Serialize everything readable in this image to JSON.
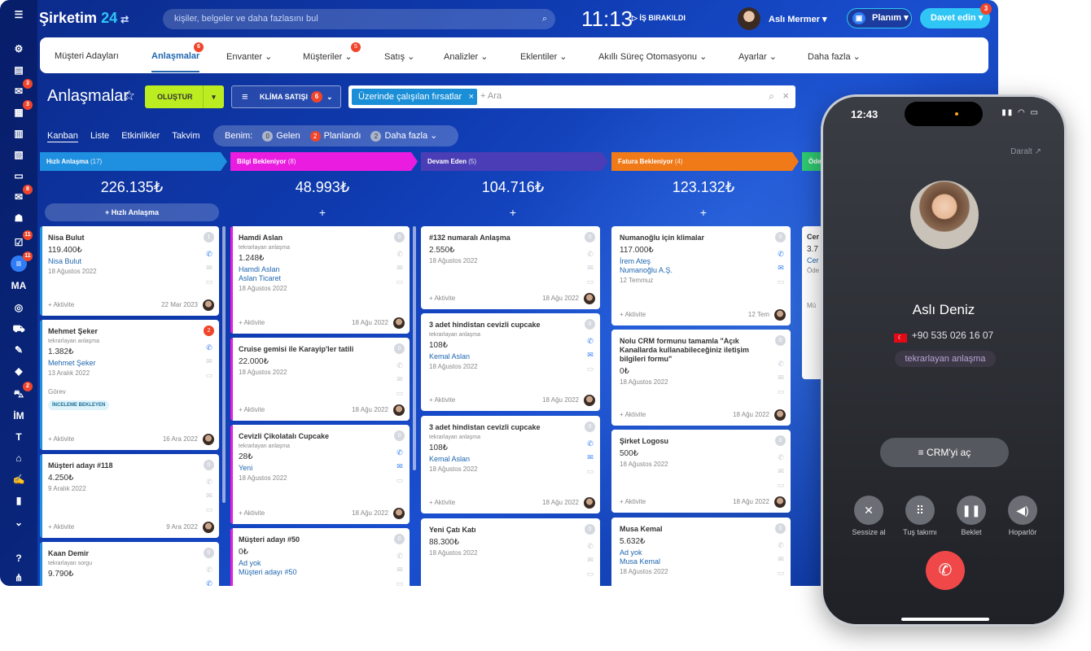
{
  "brand": {
    "name": "Şirketim",
    "num": "24"
  },
  "search": {
    "placeholder": "kişiler, belgeler ve daha fazlasını bul"
  },
  "clock": {
    "time": "11:13",
    "work": "İŞ BIRAKILDI"
  },
  "user": {
    "name": "Aslı Mermer"
  },
  "plan": {
    "label": "Planım"
  },
  "invite": {
    "label": "Davet edin",
    "badge": "3"
  },
  "sidebar": {
    "badges": [
      "3",
      "3",
      "8",
      "11",
      "11",
      "2"
    ],
    "labels": [
      "MA",
      "İM",
      "T"
    ]
  },
  "menu": {
    "items": [
      "Müşteri Adayları",
      "Anlaşmalar",
      "Envanter",
      "Müşteriler",
      "Satış",
      "Analizler",
      "Eklentiler",
      "Akıllı Süreç Otomasyonu",
      "Ayarlar",
      "Daha fazla"
    ],
    "badges": {
      "deals": "6",
      "customers": "5"
    }
  },
  "page": {
    "title": "Anlaşmalar",
    "create": "OLUŞTUR",
    "category": "KLİMA SATIŞI",
    "category_badge": "6",
    "filter_chip": "Üzerinde çalışılan fırsatlar",
    "filter_ph": "+ Ara"
  },
  "views": [
    "Kanban",
    "Liste",
    "Etkinlikler",
    "Takvim"
  ],
  "benim": {
    "label": "Benim:",
    "gelen_count": "0",
    "gelen": "Gelen",
    "plan_count": "2",
    "plan": "Planlandı",
    "more_count": "2",
    "more": "Daha fazla"
  },
  "columns": [
    {
      "name": "Hızlı Anlaşma",
      "count": "(17)",
      "total": "226.135₺",
      "color": "#1f8fe0",
      "quick": "Hızlı Anlaşma"
    },
    {
      "name": "Bilgi Bekleniyor",
      "count": "(8)",
      "total": "48.993₺",
      "color": "#ea1ce0"
    },
    {
      "name": "Devam Eden",
      "count": "(5)",
      "total": "104.716₺",
      "color": "#4b3db5"
    },
    {
      "name": "Fatura Bekleniyor",
      "count": "(4)",
      "total": "123.132₺",
      "color": "#f07a18"
    },
    {
      "name": "Öde"
    }
  ],
  "cards": {
    "c0": [
      {
        "title": "Nisa Bulut",
        "price": "119.400₺",
        "link": "Nisa Bulut",
        "date": "18 Ağustos 2022",
        "badge": "1",
        "aktivite": "+ Aktivite",
        "adate": "22 Mar 2023"
      },
      {
        "title": "Mehmet Şeker",
        "sub": "tekrarlayan anlaşma",
        "price": "1.382₺",
        "link": "Mehmet Şeker",
        "date": "13 Aralık 2022",
        "badge": "2",
        "gorev": "Görev",
        "tag": "İNCELEME BEKLEYEN",
        "aktivite": "+ Aktivite",
        "adate": "16 Ara 2022"
      },
      {
        "title": "Müşteri adayı #118",
        "price": "4.250₺",
        "date": "9 Aralık 2022",
        "badge": "0",
        "aktivite": "+ Aktivite",
        "adate": "9 Ara 2022"
      },
      {
        "title": "Kaan Demir",
        "sub": "tekrarlayan sorgu",
        "price": "9.790₺",
        "badge": "0"
      }
    ],
    "c1": [
      {
        "title": "Hamdi Aslan",
        "sub": "tekrarlayan anlaşma",
        "price": "1.248₺",
        "link": "Hamdi Aslan",
        "link2": "Aslan Ticaret",
        "date": "18 Ağustos 2022",
        "badge": "0",
        "aktivite": "+ Aktivite",
        "adate": "18 Ağu 2022"
      },
      {
        "title": "Cruise gemisi ile Karayip'ler tatili",
        "price": "22.000₺",
        "date": "18 Ağustos 2022",
        "badge": "0",
        "aktivite": "+ Aktivite",
        "adate": "18 Ağu 2022"
      },
      {
        "title": "Cevizli Çikolatalı Cupcake",
        "sub": "tekrarlayan anlaşma",
        "price": "28₺",
        "link": "Yeni",
        "date": "18 Ağustos 2022",
        "badge": "0",
        "aktivite": "+ Aktivite",
        "adate": "18 Ağu 2022"
      },
      {
        "title": "Müşteri adayı #50",
        "price": "0₺",
        "link": "Ad yok",
        "link2": "Müşteri adayı #50",
        "badge": "0"
      }
    ],
    "c2": [
      {
        "title": "#132 numaralı Anlaşma",
        "price": "2.550₺",
        "date": "18 Ağustos 2022",
        "badge": "0",
        "aktivite": "+ Aktivite",
        "adate": "18 Ağu 2022"
      },
      {
        "title": "3 adet hindistan cevizli cupcake",
        "sub": "tekrarlayan anlaşma",
        "price": "108₺",
        "link": "Kemal Aslan",
        "date": "18 Ağustos 2022",
        "badge": "0",
        "aktivite": "+ Aktivite",
        "adate": "18 Ağu 2022"
      },
      {
        "title": "3 adet hindistan cevizli cupcake",
        "sub": "tekrarlayan anlaşma",
        "price": "108₺",
        "link": "Kemal Aslan",
        "date": "18 Ağustos 2022",
        "badge": "0",
        "aktivite": "+ Aktivite",
        "adate": "18 Ağu 2022"
      },
      {
        "title": "Yeni Çatı Katı",
        "price": "88.300₺",
        "date": "18 Ağustos 2022",
        "badge": "0"
      }
    ],
    "c3": [
      {
        "title": "Numanoğlu için klimalar",
        "price": "117.000₺",
        "link": "İrem Ateş",
        "link2": "Numanoğlu A.Ş.",
        "date": "12 Temmuz",
        "badge": "0",
        "aktivite": "+ Aktivite",
        "adate": "12 Tem"
      },
      {
        "title": "Nolu CRM formunu tamamla \"Açık Kanallarda kullanabileceğiniz iletişim bilgileri formu\"",
        "price": "0₺",
        "date": "18 Ağustos 2022",
        "badge": "0",
        "aktivite": "+ Aktivite",
        "adate": "18 Ağu 2022"
      },
      {
        "title": "Şirket Logosu",
        "price": "500₺",
        "date": "18 Ağustos 2022",
        "badge": "0",
        "aktivite": "+ Aktivite",
        "adate": "18 Ağu 2022"
      },
      {
        "title": "Musa Kemal",
        "price": "5.632₺",
        "link": "Ad yok",
        "link2": "Musa Kemal",
        "date": "18 Ağustos 2022",
        "badge": "0"
      }
    ]
  },
  "peek": [
    "Cer",
    "3.7",
    "Cer",
    "Öde",
    "Mü"
  ],
  "phone": {
    "time": "12:43",
    "collapse": "Daralt",
    "name": "Aslı Deniz",
    "number": "+90 535 026 16 07",
    "tag": "tekrarlayan anlaşma",
    "crm": "CRM'yi aç",
    "buttons": [
      "Sessize al",
      "Tuş takımı",
      "Beklet",
      "Hoparlör"
    ]
  }
}
